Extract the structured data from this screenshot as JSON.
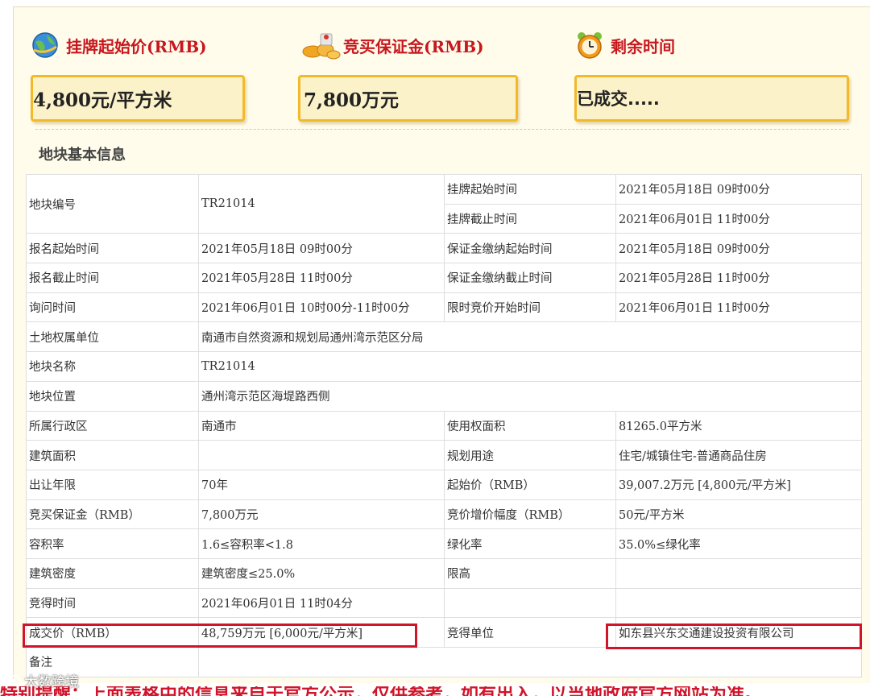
{
  "header": {
    "start_price_label": "挂牌起始价(RMB)",
    "deposit_label": "竞买保证金(RMB)",
    "remaining_label": "剩余时间",
    "start_price_value": "4,800元/平方米",
    "deposit_value": "7,800万元",
    "remaining_value": "已成交....."
  },
  "section_title": "地块基本信息",
  "table": {
    "r1": {
      "k1": "地块编号",
      "v1": "TR21014",
      "k2a": "挂牌起始时间",
      "v2a": "2021年05月18日 09时00分",
      "k2b": "挂牌截止时间",
      "v2b": "2021年06月01日 11时00分"
    },
    "r2": {
      "k1": "报名起始时间",
      "v1": "2021年05月18日 09时00分",
      "k2": "保证金缴纳起始时间",
      "v2": "2021年05月18日 09时00分"
    },
    "r3": {
      "k1": "报名截止时间",
      "v1": "2021年05月28日 11时00分",
      "k2": "保证金缴纳截止时间",
      "v2": "2021年05月28日 11时00分"
    },
    "r4": {
      "k1": "询问时间",
      "v1": "2021年06月01日 10时00分-11时00分",
      "k2": "限时竞价开始时间",
      "v2": "2021年06月01日 11时00分"
    },
    "r5": {
      "k1": "土地权属单位",
      "v1": "南通市自然资源和规划局通州湾示范区分局"
    },
    "r6": {
      "k1": "地块名称",
      "v1": "TR21014"
    },
    "r7": {
      "k1": "地块位置",
      "v1": "通州湾示范区海堤路西侧"
    },
    "r8": {
      "k1": "所属行政区",
      "v1": "南通市",
      "k2": "使用权面积",
      "v2": "81265.0平方米"
    },
    "r9": {
      "k1": "建筑面积",
      "v1": "",
      "k2": "规划用途",
      "v2": "住宅/城镇住宅-普通商品住房"
    },
    "r10": {
      "k1": "出让年限",
      "v1": "70年",
      "k2": "起始价（RMB）",
      "v2": "39,007.2万元 [4,800元/平方米]"
    },
    "r11": {
      "k1": "竞买保证金（RMB）",
      "v1": "7,800万元",
      "k2": "竞价增价幅度（RMB）",
      "v2": "50元/平方米"
    },
    "r12": {
      "k1": "容积率",
      "v1": "1.6≤容积率<1.8",
      "k2": "绿化率",
      "v2": "35.0%≤绿化率"
    },
    "r13": {
      "k1": "建筑密度",
      "v1": "建筑密度≤25.0%",
      "k2": "限高",
      "v2": ""
    },
    "r14": {
      "k1": "竞得时间",
      "v1": "2021年06月01日 11时04分",
      "k2": "",
      "v2": ""
    },
    "r15": {
      "k1": "成交价（RMB）",
      "v1": "48,759万元 [6,000元/平方米]",
      "k2": "竞得单位",
      "v2": "如东县兴东交通建设投资有限公司"
    },
    "r16": {
      "k1": "备注",
      "v1": ""
    }
  },
  "watermark": "大数跨境",
  "bottom_caption": "特别提醒：上面表格中的信息来自于官方公示，仅供参考，如有出入，以当地政府官方网站为准。"
}
